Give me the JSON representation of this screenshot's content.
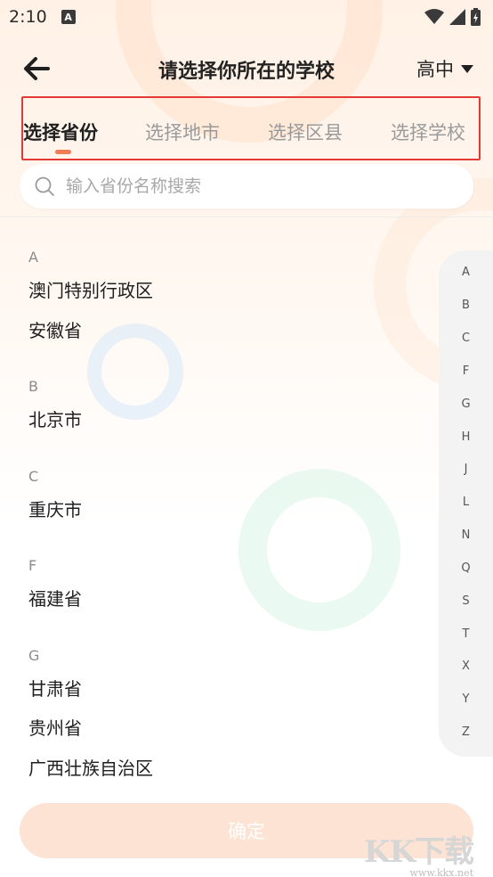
{
  "status_bar": {
    "time": "2:10",
    "notification_letter": "A"
  },
  "header": {
    "title": "请选择你所在的学校",
    "level": "高中"
  },
  "tabs": [
    {
      "label": "选择省份",
      "active": true
    },
    {
      "label": "选择地市",
      "active": false
    },
    {
      "label": "选择区县",
      "active": false
    },
    {
      "label": "选择学校",
      "active": false
    }
  ],
  "search": {
    "placeholder": "输入省份名称搜索"
  },
  "groups": [
    {
      "letter": "A",
      "items": [
        "澳门特别行政区",
        "安徽省"
      ]
    },
    {
      "letter": "B",
      "items": [
        "北京市"
      ]
    },
    {
      "letter": "C",
      "items": [
        "重庆市"
      ]
    },
    {
      "letter": "F",
      "items": [
        "福建省"
      ]
    },
    {
      "letter": "G",
      "items": [
        "甘肃省",
        "贵州省",
        "广西壮族自治区"
      ]
    }
  ],
  "index_letters": [
    "A",
    "B",
    "C",
    "F",
    "G",
    "H",
    "J",
    "L",
    "N",
    "Q",
    "S",
    "T",
    "X",
    "Y",
    "Z"
  ],
  "confirm_label": "确定",
  "watermark": {
    "logo": "KK下载",
    "url": "www.kkx.net"
  },
  "colors": {
    "accent": "#f07c55",
    "confirm_bg": "#fde3d3",
    "highlight_border": "#e53935"
  }
}
